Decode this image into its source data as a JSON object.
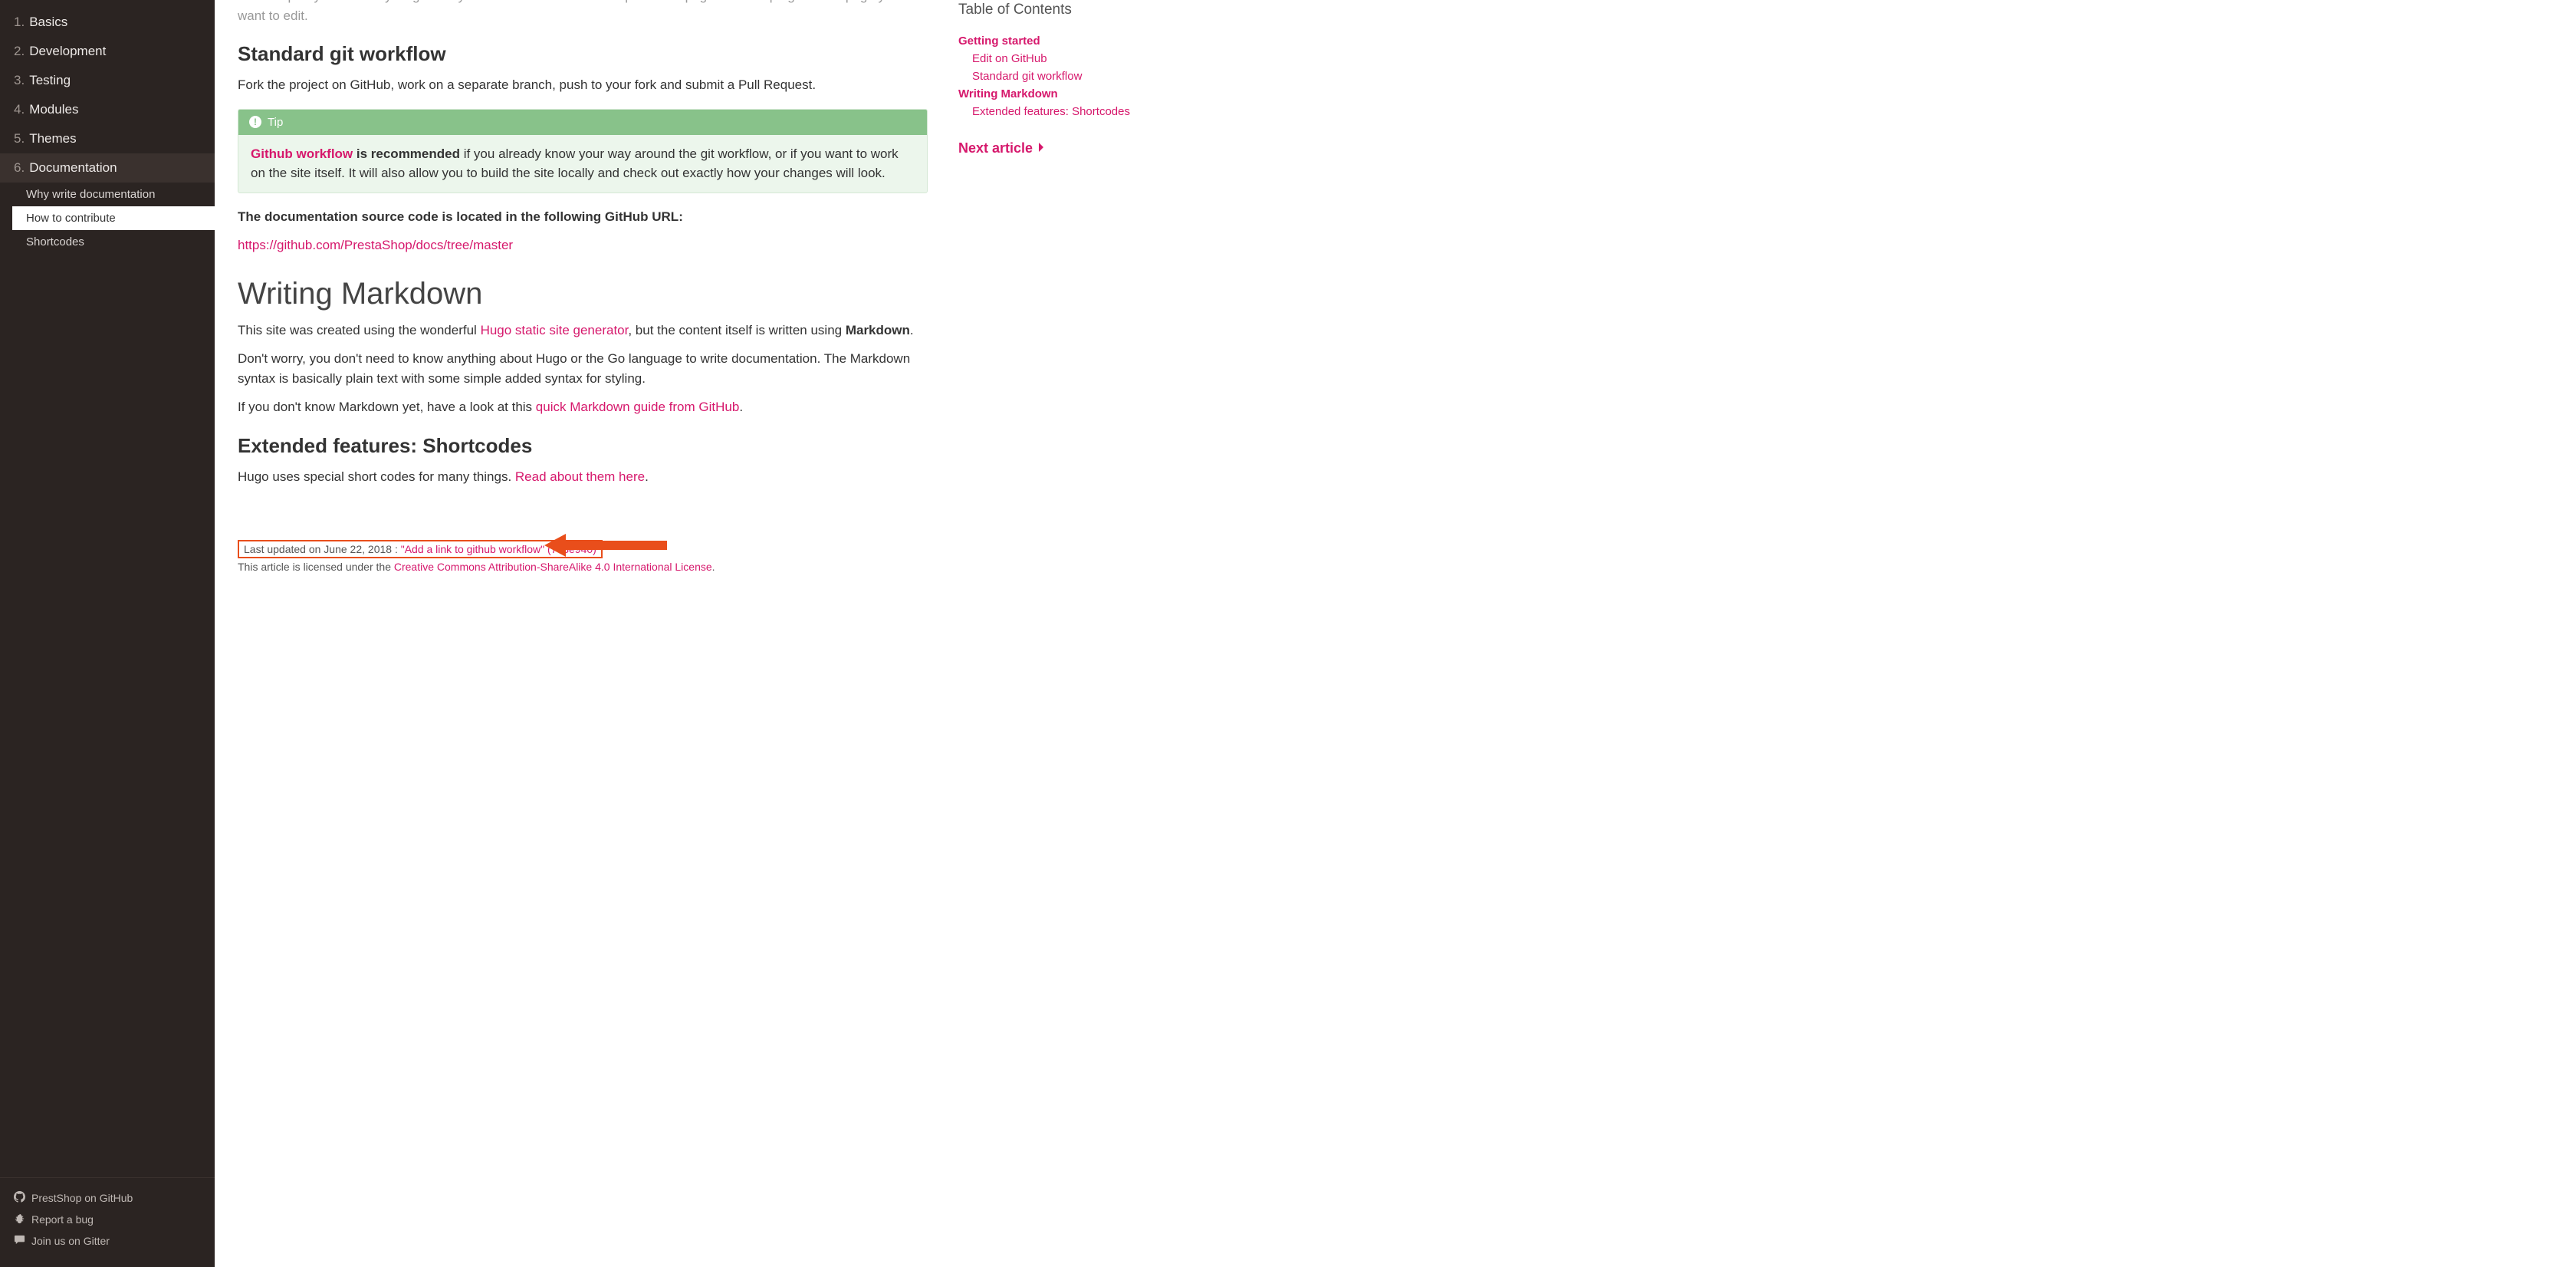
{
  "sidebar": {
    "items": [
      {
        "num": "1.",
        "label": "Basics"
      },
      {
        "num": "2.",
        "label": "Development"
      },
      {
        "num": "3.",
        "label": "Testing"
      },
      {
        "num": "4.",
        "label": "Modules"
      },
      {
        "num": "5.",
        "label": "Themes"
      },
      {
        "num": "6.",
        "label": "Documentation"
      }
    ],
    "subitems": [
      {
        "label": "Why write documentation"
      },
      {
        "label": "How to contribute"
      },
      {
        "label": "Shortcodes"
      }
    ],
    "footer": [
      {
        "label": "PrestShop on GitHub"
      },
      {
        "label": "Report a bug"
      },
      {
        "label": "Join us on Gitter"
      }
    ]
  },
  "content": {
    "truncated_top": "You can pretty much everything directly on GitHub. Click on the \"Improve this page\" at the top right of the page you want to edit.",
    "h2_standard": "Standard git workflow",
    "p_fork": "Fork the project on GitHub, work on a separate branch, push to your fork and submit a Pull Request.",
    "tip_label": "Tip",
    "tip_link": "Github workflow",
    "tip_bold": " is recommended",
    "tip_rest": " if you already know your way around the git workflow, or if you want to work on the site itself. It will also allow you to build the site locally and check out exactly how your changes will look.",
    "p_src_bold": "The documentation source code is located in the following GitHub URL:",
    "src_url": "https://github.com/PrestaShop/docs/tree/master",
    "h1_md": "Writing Markdown",
    "p_md1_pre": "This site was created using the wonderful ",
    "p_md1_link": "Hugo static site generator",
    "p_md1_mid": ", but the content itself is written using ",
    "p_md1_bold": "Markdown",
    "p_md1_end": ".",
    "p_md2": "Don't worry, you don't need to know anything about Hugo or the Go language to write documentation. The Markdown syntax is basically plain text with some simple added syntax for styling.",
    "p_md3_pre": "If you don't know Markdown yet, have a look at this ",
    "p_md3_link": "quick Markdown guide from GitHub",
    "p_md3_end": ".",
    "h2_ext": "Extended features: Shortcodes",
    "p_ext_pre": "Hugo uses special short codes for many things. ",
    "p_ext_link": "Read about them here",
    "p_ext_end": ".",
    "updated_pre": "Last updated on June 22, 2018 : ",
    "updated_link": "\"Add a link to github workflow\" (753e940)",
    "license_pre": "This article is licensed under the ",
    "license_link": "Creative Commons Attribution-ShareAlike 4.0 International License",
    "license_end": "."
  },
  "toc": {
    "title": "Table of Contents",
    "items": [
      {
        "label": "Getting started",
        "level": 1
      },
      {
        "label": "Edit on GitHub",
        "level": 2
      },
      {
        "label": "Standard git workflow",
        "level": 2
      },
      {
        "label": "Writing Markdown",
        "level": 1
      },
      {
        "label": "Extended features: Shortcodes",
        "level": 2
      }
    ],
    "next": "Next article"
  }
}
